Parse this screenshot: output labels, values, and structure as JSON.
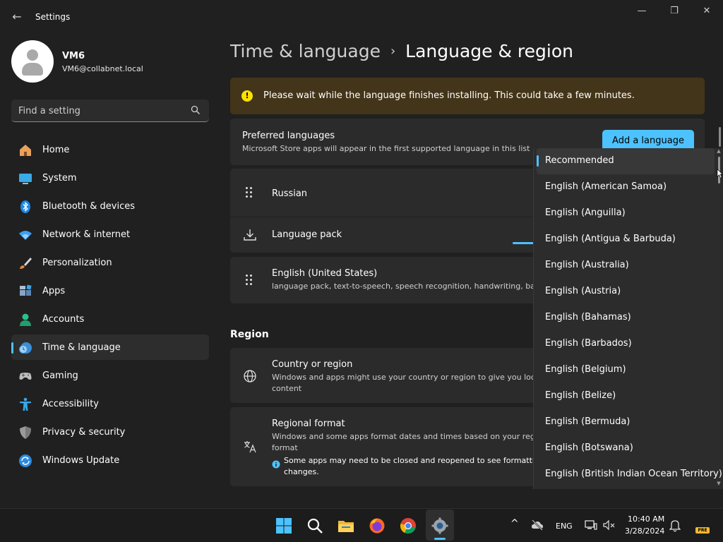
{
  "window": {
    "title": "Settings",
    "back_glyph": "←",
    "minimize_glyph": "—",
    "maximize_glyph": "❐",
    "close_glyph": "✕"
  },
  "profile": {
    "name": "VM6",
    "email": "VM6@collabnet.local"
  },
  "search": {
    "placeholder": "Find a setting"
  },
  "nav": {
    "items": [
      {
        "label": "Home",
        "icon": "home-icon"
      },
      {
        "label": "System",
        "icon": "system-icon"
      },
      {
        "label": "Bluetooth & devices",
        "icon": "bluetooth-icon"
      },
      {
        "label": "Network & internet",
        "icon": "wifi-icon"
      },
      {
        "label": "Personalization",
        "icon": "brush-icon"
      },
      {
        "label": "Apps",
        "icon": "apps-icon"
      },
      {
        "label": "Accounts",
        "icon": "accounts-icon"
      },
      {
        "label": "Time & language",
        "icon": "time-language-icon",
        "selected": true
      },
      {
        "label": "Gaming",
        "icon": "gamepad-icon"
      },
      {
        "label": "Accessibility",
        "icon": "accessibility-icon"
      },
      {
        "label": "Privacy & security",
        "icon": "shield-icon"
      },
      {
        "label": "Windows Update",
        "icon": "update-icon"
      }
    ]
  },
  "header": {
    "parent": "Time & language",
    "separator": "›",
    "current": "Language & region"
  },
  "warning": {
    "text": "Please wait while the language finishes installing. This could take a few minutes.",
    "glyph": "!"
  },
  "preferred": {
    "title": "Preferred languages",
    "subtitle": "Microsoft Store apps will appear in the first supported language in this list",
    "add_button": "Add a language"
  },
  "languages": {
    "russian": "Russian",
    "language_pack": "Language pack",
    "language_pack_progress": 0.2,
    "english_title": "English (United States)",
    "english_sub": "language pack, text-to-speech, speech recognition, handwriting, bas"
  },
  "region": {
    "section": "Region",
    "country_title": "Country or region",
    "country_sub_1": "Windows and apps might use your country or region to give you loc",
    "country_sub_2": "content",
    "format_title": "Regional format",
    "format_sub_1": "Windows and some apps format dates and times based on your regi",
    "format_sub_2": "format",
    "format_note_1": "Some apps may need to be closed and reopened to see formattin",
    "format_note_2": "changes."
  },
  "dropdown": {
    "items": [
      "Recommended",
      "English (American Samoa)",
      "English (Anguilla)",
      "English (Antigua & Barbuda)",
      "English (Australia)",
      "English (Austria)",
      "English (Bahamas)",
      "English (Barbados)",
      "English (Belgium)",
      "English (Belize)",
      "English (Bermuda)",
      "English (Botswana)",
      "English (British Indian Ocean Territory)"
    ],
    "up_arrow": "▲",
    "down_arrow": "▼"
  },
  "taskbar": {
    "language": "ENG",
    "time": "10:40 AM",
    "date": "3/28/2024",
    "badge": "PRE",
    "chevron": "^"
  },
  "colors": {
    "accent": "#4cc2ff",
    "warning_bg": "#433519",
    "warning_icon": "#fce100"
  }
}
